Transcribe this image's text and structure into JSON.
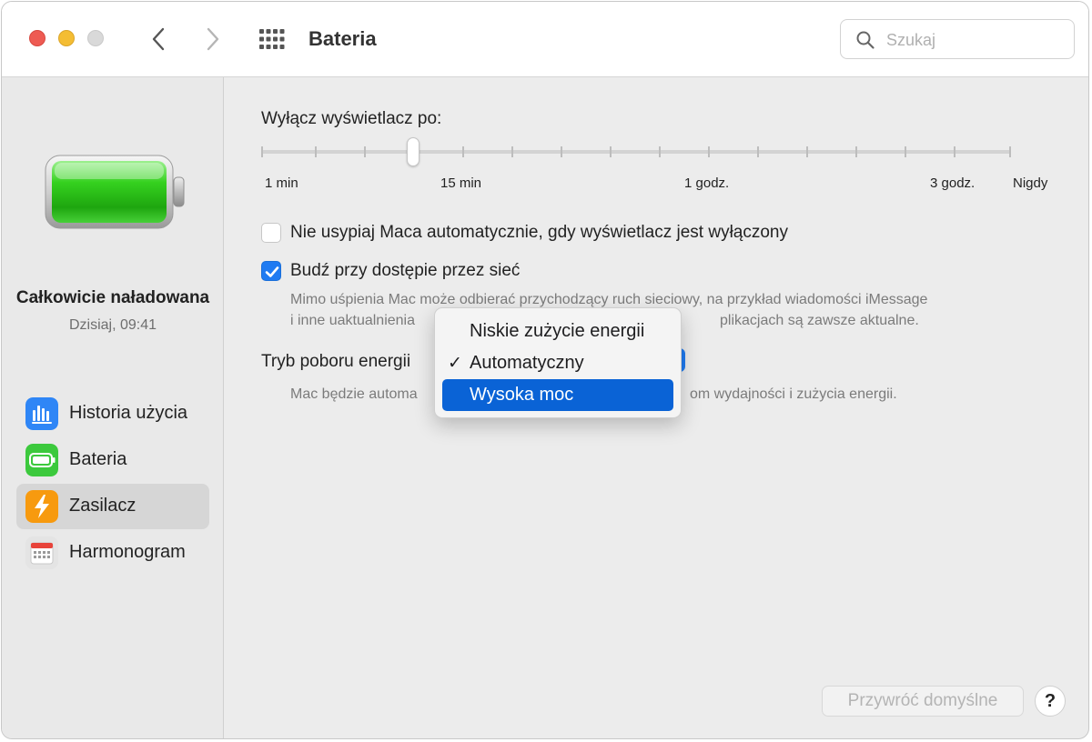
{
  "window": {
    "title": "Bateria"
  },
  "search": {
    "placeholder": "Szukaj"
  },
  "status": {
    "title": "Całkowicie naładowana",
    "subtitle": "Dzisiaj, 09:41"
  },
  "sidebar": {
    "items": [
      {
        "label": "Historia użycia",
        "icon": "usage-history-icon"
      },
      {
        "label": "Bateria",
        "icon": "battery-icon"
      },
      {
        "label": "Zasilacz",
        "icon": "power-adapter-icon"
      },
      {
        "label": "Harmonogram",
        "icon": "schedule-calendar-icon"
      }
    ],
    "selected_index": 2
  },
  "display_off": {
    "label": "Wyłącz wyświetlacz po:",
    "ticks": [
      "1 min",
      "15 min",
      "1 godz.",
      "3 godz.",
      "Nigdy"
    ],
    "value": "10 min"
  },
  "options": {
    "prevent_sleep": {
      "label": "Nie usypiaj Maca automatycznie, gdy wyświetlacz jest wyłączony",
      "checked": false
    },
    "wake_network": {
      "label": "Budź przy dostępie przez sieć",
      "checked": true,
      "desc_line1": "Mimo uśpienia Mac może odbierać przychodzący ruch sieciowy, na przykład wiadomości iMessage",
      "desc_line2_left": "i inne uaktualnienia",
      "desc_line2_right": "plikacjach są zawsze aktualne."
    }
  },
  "energy_mode": {
    "label": "Tryb poboru energii",
    "desc_left": "Mac będzie automa",
    "desc_right": "om wydajności i zużycia energii.",
    "menu": [
      "Niskie zużycie energii",
      "Automatyczny",
      "Wysoka moc"
    ],
    "checked_index": 1,
    "highlighted_index": 2
  },
  "buttons": {
    "restore": "Przywróć domyślne",
    "help": "?"
  },
  "colors": {
    "accent": "#1f7bf2",
    "menu_highlight": "#0a63d6",
    "battery_fill": "#34c925"
  }
}
